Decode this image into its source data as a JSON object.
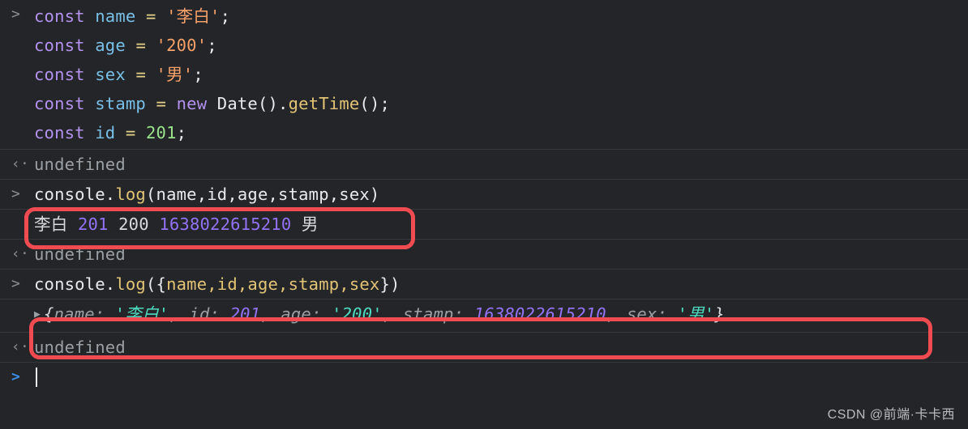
{
  "console": {
    "theme": {
      "background": "#242528",
      "separator": "#35373a",
      "annotation_color": "#f04b50",
      "prompt_color": "#8b8f95",
      "active_prompt_color": "#3b8eea"
    },
    "prompt_glyph": ">",
    "result_glyph": "‹·",
    "expand_glyph": "▶",
    "entries": [
      {
        "type": "input-block",
        "gutter": ">",
        "lines": [
          {
            "tokens": [
              {
                "t": "const",
                "c": "kw"
              },
              {
                "t": " ",
                "c": "plain"
              },
              {
                "t": "name",
                "c": "var"
              },
              {
                "t": " ",
                "c": "plain"
              },
              {
                "t": "=",
                "c": "op"
              },
              {
                "t": " ",
                "c": "plain"
              },
              {
                "t": "'李白'",
                "c": "str"
              },
              {
                "t": ";",
                "c": "plain"
              }
            ]
          },
          {
            "tokens": [
              {
                "t": "const",
                "c": "kw"
              },
              {
                "t": " ",
                "c": "plain"
              },
              {
                "t": "age",
                "c": "var"
              },
              {
                "t": " ",
                "c": "plain"
              },
              {
                "t": "=",
                "c": "op"
              },
              {
                "t": " ",
                "c": "plain"
              },
              {
                "t": "'200'",
                "c": "str"
              },
              {
                "t": ";",
                "c": "plain"
              }
            ]
          },
          {
            "tokens": [
              {
                "t": "const",
                "c": "kw"
              },
              {
                "t": " ",
                "c": "plain"
              },
              {
                "t": "sex",
                "c": "var"
              },
              {
                "t": " ",
                "c": "plain"
              },
              {
                "t": "=",
                "c": "op"
              },
              {
                "t": " ",
                "c": "plain"
              },
              {
                "t": "'男'",
                "c": "str"
              },
              {
                "t": ";",
                "c": "plain"
              }
            ]
          },
          {
            "tokens": [
              {
                "t": "const",
                "c": "kw"
              },
              {
                "t": " ",
                "c": "plain"
              },
              {
                "t": "stamp",
                "c": "var"
              },
              {
                "t": " ",
                "c": "plain"
              },
              {
                "t": "=",
                "c": "op"
              },
              {
                "t": " ",
                "c": "plain"
              },
              {
                "t": "new",
                "c": "kw"
              },
              {
                "t": " Date().",
                "c": "plain"
              },
              {
                "t": "getTime",
                "c": "fn"
              },
              {
                "t": "();",
                "c": "plain"
              }
            ]
          },
          {
            "tokens": [
              {
                "t": "const",
                "c": "kw"
              },
              {
                "t": " ",
                "c": "plain"
              },
              {
                "t": "id",
                "c": "var"
              },
              {
                "t": " ",
                "c": "plain"
              },
              {
                "t": "=",
                "c": "op"
              },
              {
                "t": " ",
                "c": "plain"
              },
              {
                "t": "201",
                "c": "num"
              },
              {
                "t": ";",
                "c": "plain"
              }
            ]
          }
        ]
      },
      {
        "type": "result",
        "gutter": "‹·",
        "text": "undefined",
        "style": "muted"
      },
      {
        "type": "input",
        "gutter": ">",
        "tokens": [
          {
            "t": "console.",
            "c": "plain"
          },
          {
            "t": "log",
            "c": "fn"
          },
          {
            "t": "(name,id,age,stamp,sex)",
            "c": "plain"
          }
        ]
      },
      {
        "type": "output",
        "gutter": "",
        "annotated": true,
        "tokens": [
          {
            "t": "李白",
            "c": "r-txt"
          },
          {
            "t": " ",
            "c": "r-txt"
          },
          {
            "t": "201",
            "c": "r-num"
          },
          {
            "t": " ",
            "c": "r-txt"
          },
          {
            "t": "200",
            "c": "r-txt"
          },
          {
            "t": " ",
            "c": "r-txt"
          },
          {
            "t": "1638022615210",
            "c": "r-num"
          },
          {
            "t": " ",
            "c": "r-txt"
          },
          {
            "t": "男",
            "c": "r-txt"
          }
        ]
      },
      {
        "type": "result",
        "gutter": "‹·",
        "text": "undefined",
        "style": "muted"
      },
      {
        "type": "input",
        "gutter": ">",
        "tokens": [
          {
            "t": "console.",
            "c": "plain"
          },
          {
            "t": "log",
            "c": "fn"
          },
          {
            "t": "(",
            "c": "plain"
          },
          {
            "t": "{",
            "c": "plain"
          },
          {
            "t": "name,id,age,stamp,sex",
            "c": "key"
          },
          {
            "t": "}",
            "c": "plain"
          },
          {
            "t": ")",
            "c": "plain"
          }
        ]
      },
      {
        "type": "output-object",
        "gutter": "",
        "annotated": true,
        "expandable": true,
        "tokens": [
          {
            "t": "{",
            "c": "r-punc"
          },
          {
            "t": "name",
            "c": "r-key"
          },
          {
            "t": ": ",
            "c": "r-key"
          },
          {
            "t": "'李白'",
            "c": "r-str"
          },
          {
            "t": ", ",
            "c": "r-key"
          },
          {
            "t": "id",
            "c": "r-key"
          },
          {
            "t": ": ",
            "c": "r-key"
          },
          {
            "t": "201",
            "c": "r-inum"
          },
          {
            "t": ", ",
            "c": "r-key"
          },
          {
            "t": "age",
            "c": "r-key"
          },
          {
            "t": ": ",
            "c": "r-key"
          },
          {
            "t": "'200'",
            "c": "r-str"
          },
          {
            "t": ", ",
            "c": "r-key"
          },
          {
            "t": "stamp",
            "c": "r-key"
          },
          {
            "t": ": ",
            "c": "r-key"
          },
          {
            "t": "1638022615210",
            "c": "r-inum"
          },
          {
            "t": ", ",
            "c": "r-key"
          },
          {
            "t": "sex",
            "c": "r-key"
          },
          {
            "t": ": ",
            "c": "r-key"
          },
          {
            "t": "'男'",
            "c": "r-str"
          },
          {
            "t": "}",
            "c": "r-punc"
          }
        ]
      },
      {
        "type": "result",
        "gutter": "‹·",
        "text": "undefined",
        "style": "muted"
      },
      {
        "type": "prompt",
        "gutter": ">",
        "text": ""
      }
    ]
  },
  "watermark": {
    "text": "CSDN @前端·卡卡西"
  }
}
